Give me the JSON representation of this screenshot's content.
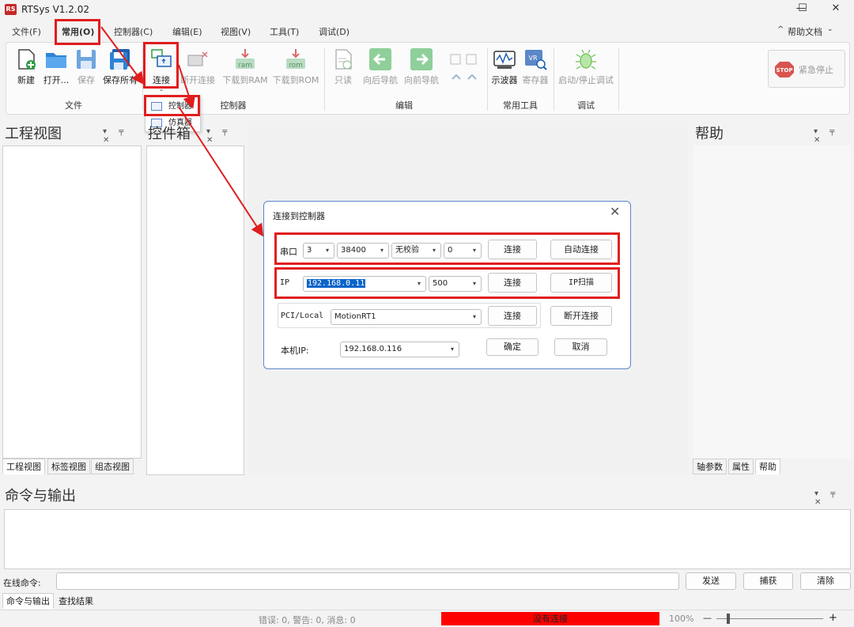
{
  "window": {
    "title": "RTSys V1.2.02",
    "controls": {
      "minimize": "—",
      "maximize": "☐",
      "close": "✕"
    },
    "app_icon_text": "RS"
  },
  "menubar": {
    "items": [
      "文件(F)",
      "常用(O)",
      "控制器(C)",
      "编辑(E)",
      "视图(V)",
      "工具(T)",
      "调试(D)"
    ],
    "help_docs": "帮助文档",
    "collapse": "^",
    "help_icon": "?"
  },
  "ribbon": {
    "file_group": {
      "label": "文件",
      "buttons": [
        "新建",
        "打开...",
        "保存",
        "保存所有"
      ]
    },
    "controller_group": {
      "label": "控制器",
      "buttons": [
        "连接",
        "断开连接",
        "下载到RAM",
        "下载到ROM"
      ],
      "ram_text": "ram",
      "rom_text": "rom"
    },
    "edit_group": {
      "label": "编辑",
      "buttons": [
        "只读",
        "向后导航",
        "向前导航"
      ]
    },
    "tools_group": {
      "label": "常用工具",
      "buttons": [
        "示波器",
        "寄存器"
      ],
      "register_text": "VR"
    },
    "debug_group": {
      "label": "调试",
      "buttons": [
        "启动/停止调试"
      ]
    },
    "emergency_stop": {
      "label": "紧急停止",
      "stop_text": "STOP"
    }
  },
  "connect_dropdown": {
    "items": [
      "控制器",
      "仿真器"
    ]
  },
  "left_panel": {
    "title": "工程视图",
    "tabs": [
      "工程视图",
      "标签视图",
      "组态视图"
    ]
  },
  "middle_panel": {
    "title": "控件箱"
  },
  "right_panel": {
    "title": "帮助",
    "tabs": [
      "轴参数",
      "属性",
      "帮助"
    ]
  },
  "panel_controls": "▾ ╤ ✕",
  "dialog": {
    "title": "连接到控制器",
    "close": "✕",
    "serial": {
      "label": "串口",
      "port": "3",
      "baud": "38400",
      "parity": "无校验",
      "extra": "0",
      "connect": "连接",
      "auto_connect": "自动连接"
    },
    "ip": {
      "label": "IP",
      "address": "192.168.0.11",
      "timeout": "500",
      "connect": "连接",
      "scan": "IP扫描"
    },
    "pci": {
      "label": "PCI/Local",
      "device": "MotionRT1",
      "connect": "连接",
      "disconnect": "断开连接"
    },
    "local_ip": {
      "label": "本机IP:",
      "address": "192.168.0.116",
      "ok": "确定",
      "cancel": "取消"
    }
  },
  "output_panel": {
    "title": "命令与输出",
    "online_cmd_label": "在线命令:",
    "online_cmd_value": "",
    "buttons": [
      "发送",
      "捕获",
      "清除"
    ],
    "tabs": [
      "命令与输出",
      "查找结果"
    ]
  },
  "statusbar": {
    "messages": "错误: 0, 警告: 0, 消息: 0",
    "connection": "没有连接",
    "zoom": "100%",
    "zoom_minus": "—",
    "zoom_plus": "+"
  },
  "colors": {
    "annotation_red": "#e01e1e",
    "not_connected_bg": "#ff0000",
    "dialog_border": "#5b87c8",
    "selection_blue": "#0a64c8"
  }
}
